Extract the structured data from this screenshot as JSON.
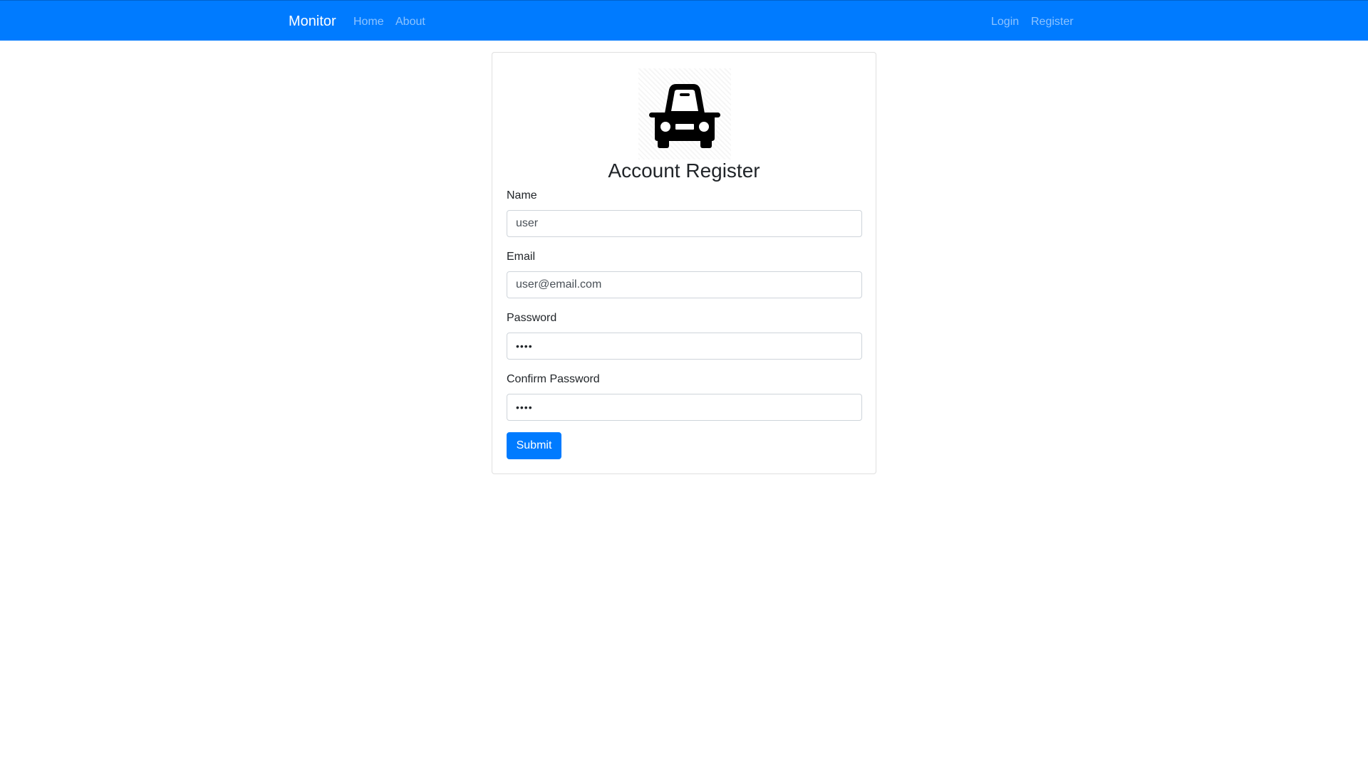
{
  "navbar": {
    "brand": "Monitor",
    "left_links": [
      "Home",
      "About"
    ],
    "right_links": [
      "Login",
      "Register"
    ],
    "background_color": "#007bff"
  },
  "card": {
    "logo_icon": "car-icon",
    "title": "Account Register",
    "fields": {
      "name": {
        "label": "Name",
        "value": "user"
      },
      "email": {
        "label": "Email",
        "value": "user@email.com"
      },
      "password": {
        "label": "Password",
        "value": "••••"
      },
      "confirm_password": {
        "label": "Confirm Password",
        "value": "••••"
      }
    },
    "submit_label": "Submit",
    "accent_color": "#007bff"
  }
}
